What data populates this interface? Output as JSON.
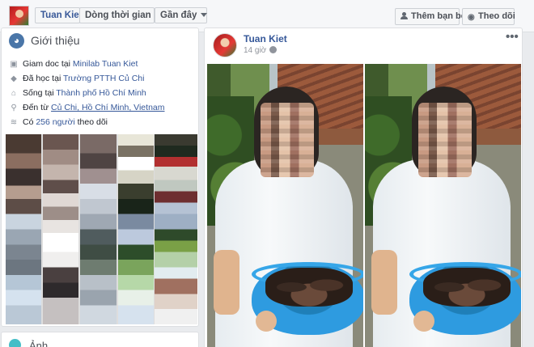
{
  "topbar": {
    "name_button": "Tuan Kiet",
    "timeline_dropdown": "Dòng thời gian",
    "recent_dropdown": "Gần đây",
    "add_friend_button": "Thêm bạn bè",
    "follow_button": "Theo dõi"
  },
  "intro": {
    "title": "Giới thiệu",
    "rows": [
      {
        "icon": "briefcase-icon",
        "prefix": "Giam doc tại ",
        "link": "Minilab Tuan Kiet"
      },
      {
        "icon": "graduation-cap-icon",
        "prefix": "Đã học tại ",
        "link": "Trường PTTH Củ Chi"
      },
      {
        "icon": "home-icon",
        "prefix": "Sống tại ",
        "link": "Thành phố Hồ Chí Minh"
      },
      {
        "icon": "location-pin-icon",
        "prefix": "Đến từ ",
        "link": "Củ Chi, Hồ Chí Minh, Vietnam"
      },
      {
        "icon": "rss-icon",
        "prefix": "Có ",
        "link": "256 người",
        "suffix": " theo dõi"
      }
    ]
  },
  "second_card": {
    "title": "Ảnh"
  },
  "post": {
    "author": "Tuan Kiet",
    "time": "14 giờ",
    "more_label": "•••"
  },
  "colors": {
    "link": "#365899",
    "background": "#e9ebee",
    "card": "#ffffff"
  }
}
